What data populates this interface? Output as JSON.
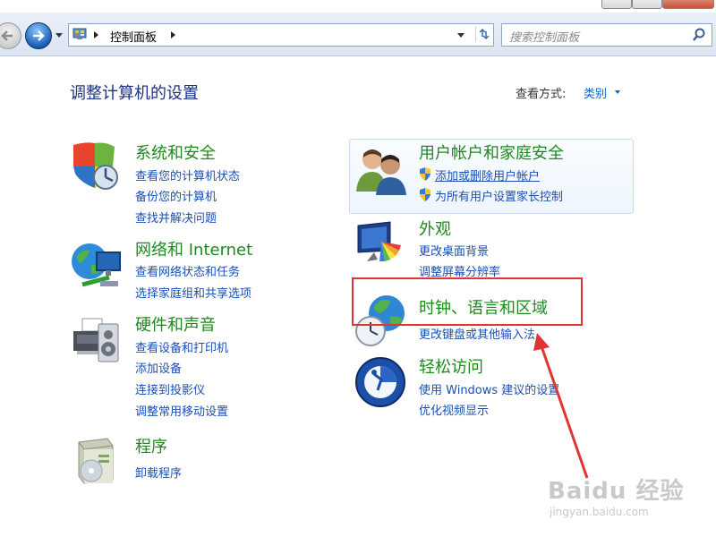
{
  "nav": {
    "crumb": "控制面板",
    "search_placeholder": "搜索控制面板"
  },
  "page": {
    "title": "调整计算机的设置",
    "view_by_label": "查看方式:",
    "view_by_value": "类别"
  },
  "categories_left": [
    {
      "title": "系统和安全",
      "links": [
        "查看您的计算机状态",
        "备份您的计算机",
        "查找并解决问题"
      ]
    },
    {
      "title": "网络和 Internet",
      "links": [
        "查看网络状态和任务",
        "选择家庭组和共享选项"
      ]
    },
    {
      "title": "硬件和声音",
      "links": [
        "查看设备和打印机",
        "添加设备",
        "连接到投影仪",
        "调整常用移动设置"
      ]
    },
    {
      "title": "程序",
      "links": [
        "卸载程序"
      ]
    }
  ],
  "categories_right": [
    {
      "title": "用户帐户和家庭安全",
      "links": [
        "添加或删除用户帐户",
        "为所有用户设置家长控制"
      ]
    },
    {
      "title": "外观",
      "links": [
        "更改桌面背景",
        "调整屏幕分辨率"
      ]
    },
    {
      "title": "时钟、语言和区域",
      "links": [
        "更改键盘或其他输入法"
      ]
    },
    {
      "title": "轻松访问",
      "links": [
        "使用 Windows 建议的设置",
        "优化视频显示"
      ]
    }
  ],
  "watermark": {
    "brand": "Baidu 经验",
    "url": "jingyan.baidu.com"
  },
  "colors": {
    "category_green": "#1e8a1e",
    "link_blue": "#1a4fb4",
    "title_blue": "#1e3287",
    "highlight_red": "#e23434"
  }
}
